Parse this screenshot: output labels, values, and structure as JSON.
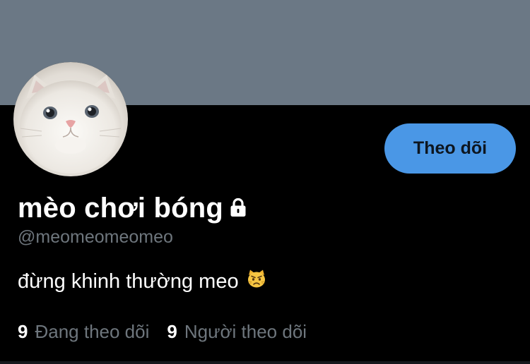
{
  "profile": {
    "display_name": "mèo chơi bóng",
    "handle": "@meomeomeomeo",
    "bio": "đừng khinh thường meo",
    "bio_emoji": "pouting-cat-icon",
    "locked": true,
    "follow_label": "Theo dõi",
    "stats": {
      "following_count": "9",
      "following_label": "Đang theo dõi",
      "followers_count": "9",
      "followers_label": "Người theo dõi"
    }
  },
  "colors": {
    "banner": "#6b7885",
    "background": "#000000",
    "accent": "#4a97e6",
    "secondary_text": "#6e767d"
  }
}
